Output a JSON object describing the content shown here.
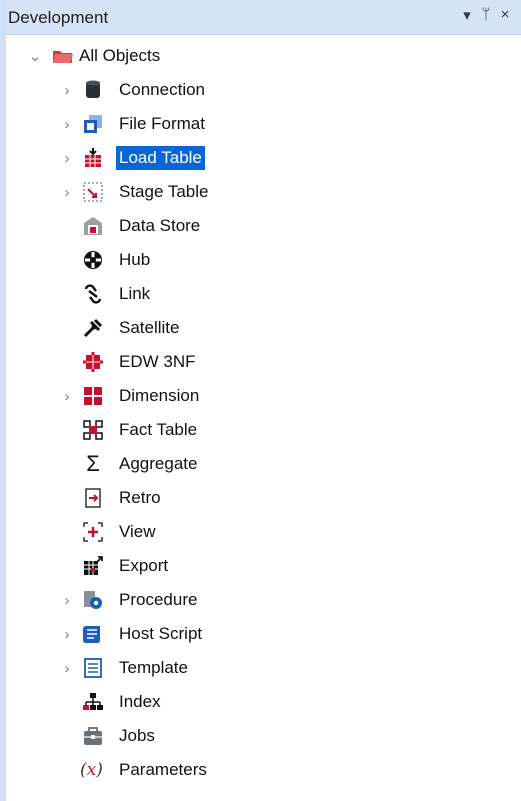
{
  "panel": {
    "title": "Development",
    "buttons": {
      "dropdown": "▾",
      "pin": "ᛘ",
      "close": "×"
    }
  },
  "tree": {
    "root": {
      "label": "All Objects",
      "expanded": true,
      "icon": "folder-open-icon"
    },
    "items": [
      {
        "label": "Connection",
        "icon": "database-icon",
        "expandable": true
      },
      {
        "label": "File Format",
        "icon": "file-format-icon",
        "expandable": true
      },
      {
        "label": "Load Table",
        "icon": "load-table-icon",
        "expandable": true,
        "selected": true
      },
      {
        "label": "Stage Table",
        "icon": "stage-table-icon",
        "expandable": true
      },
      {
        "label": "Data Store",
        "icon": "data-store-icon",
        "expandable": false
      },
      {
        "label": "Hub",
        "icon": "hub-icon",
        "expandable": false
      },
      {
        "label": "Link",
        "icon": "link-icon",
        "expandable": false
      },
      {
        "label": "Satellite",
        "icon": "satellite-icon",
        "expandable": false
      },
      {
        "label": "EDW 3NF",
        "icon": "edw-icon",
        "expandable": false
      },
      {
        "label": "Dimension",
        "icon": "dimension-icon",
        "expandable": true
      },
      {
        "label": "Fact Table",
        "icon": "fact-table-icon",
        "expandable": false
      },
      {
        "label": "Aggregate",
        "icon": "sigma-icon",
        "expandable": false
      },
      {
        "label": "Retro",
        "icon": "retro-icon",
        "expandable": false
      },
      {
        "label": "View",
        "icon": "view-icon",
        "expandable": false
      },
      {
        "label": "Export",
        "icon": "export-icon",
        "expandable": false
      },
      {
        "label": "Procedure",
        "icon": "procedure-icon",
        "expandable": true
      },
      {
        "label": "Host Script",
        "icon": "host-script-icon",
        "expandable": true
      },
      {
        "label": "Template",
        "icon": "template-icon",
        "expandable": true
      },
      {
        "label": "Index",
        "icon": "index-icon",
        "expandable": false
      },
      {
        "label": "Jobs",
        "icon": "jobs-icon",
        "expandable": false
      },
      {
        "label": "Parameters",
        "icon": "parameters-icon",
        "expandable": false
      }
    ]
  },
  "colors": {
    "selection": "#0a66d4",
    "titlebar": "#d4e3f5",
    "accent_red": "#c8102e",
    "accent_blue": "#1d5fb8"
  }
}
